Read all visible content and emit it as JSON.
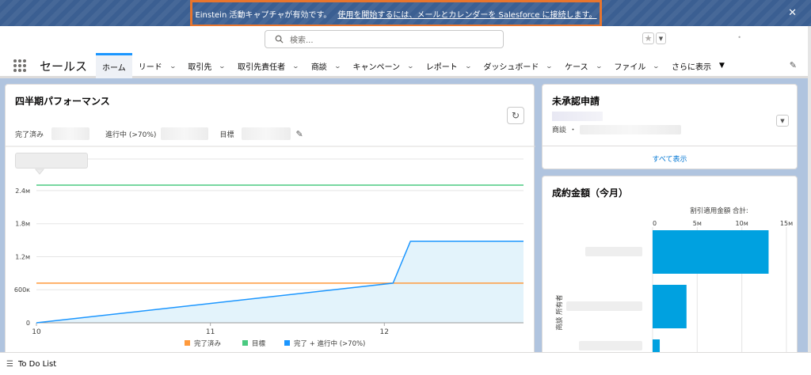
{
  "banner": {
    "text": "Einstein 活動キャプチャが有効です。",
    "link": "使用を開始するには、メールとカレンダーを Salesforce に接続します。",
    "close_icon": "close-icon"
  },
  "header": {
    "search_placeholder": "検索...",
    "favorites_icon": "star-icon"
  },
  "nav": {
    "app_name": "セールス",
    "tabs": [
      {
        "label": "ホーム",
        "active": true,
        "has_menu": false
      },
      {
        "label": "リード",
        "has_menu": true
      },
      {
        "label": "取引先",
        "has_menu": true
      },
      {
        "label": "取引先責任者",
        "has_menu": true
      },
      {
        "label": "商談",
        "has_menu": true
      },
      {
        "label": "キャンペーン",
        "has_menu": true
      },
      {
        "label": "レポート",
        "has_menu": true
      },
      {
        "label": "ダッシュボード",
        "has_menu": true
      },
      {
        "label": "ケース",
        "has_menu": true
      },
      {
        "label": "ファイル",
        "has_menu": true
      }
    ],
    "more_label": "さらに表示"
  },
  "performance": {
    "title": "四半期パフォーマンス",
    "completed_label": "完了済み",
    "in_progress_label": "進行中 (>70%)",
    "goal_label": "目標"
  },
  "pending": {
    "title": "未承認申請",
    "opportunity_label": "商談",
    "view_all": "すべて表示"
  },
  "closed": {
    "title": "成約金額（今月）",
    "axis_title": "割引適用金額 合計:",
    "y_label": "商談 所有者"
  },
  "bottom": {
    "todo_label": "To Do List"
  },
  "chart_data": [
    {
      "type": "line",
      "x_ticks": [
        "10",
        "11",
        "12"
      ],
      "y_ticks": [
        "0",
        "600к",
        "1.2м",
        "1.8м",
        "2.4м"
      ],
      "ylim": [
        0,
        2600000
      ],
      "xlim": [
        10,
        12.8
      ],
      "legend_position": "bottom",
      "series": [
        {
          "name": "完了済み",
          "color": "#ff9a3c",
          "x": [
            10,
            12.8
          ],
          "y": [
            720000,
            720000
          ]
        },
        {
          "name": "目標",
          "color": "#4bca81",
          "x": [
            10,
            12.8
          ],
          "y": [
            2500000,
            2500000
          ]
        },
        {
          "name": "完了 + 進行中 (>70%)",
          "color": "#1b96ff",
          "x": [
            10,
            12.05,
            12.15,
            12.8
          ],
          "y": [
            0,
            720000,
            1480000,
            1480000
          ]
        }
      ]
    },
    {
      "type": "bar",
      "orientation": "horizontal",
      "x_ticks": [
        "0",
        "5м",
        "10м",
        "15м"
      ],
      "xlim": [
        0,
        15000000
      ],
      "values": [
        13000000,
        3800000,
        800000
      ],
      "color": "#00a1e0"
    }
  ]
}
